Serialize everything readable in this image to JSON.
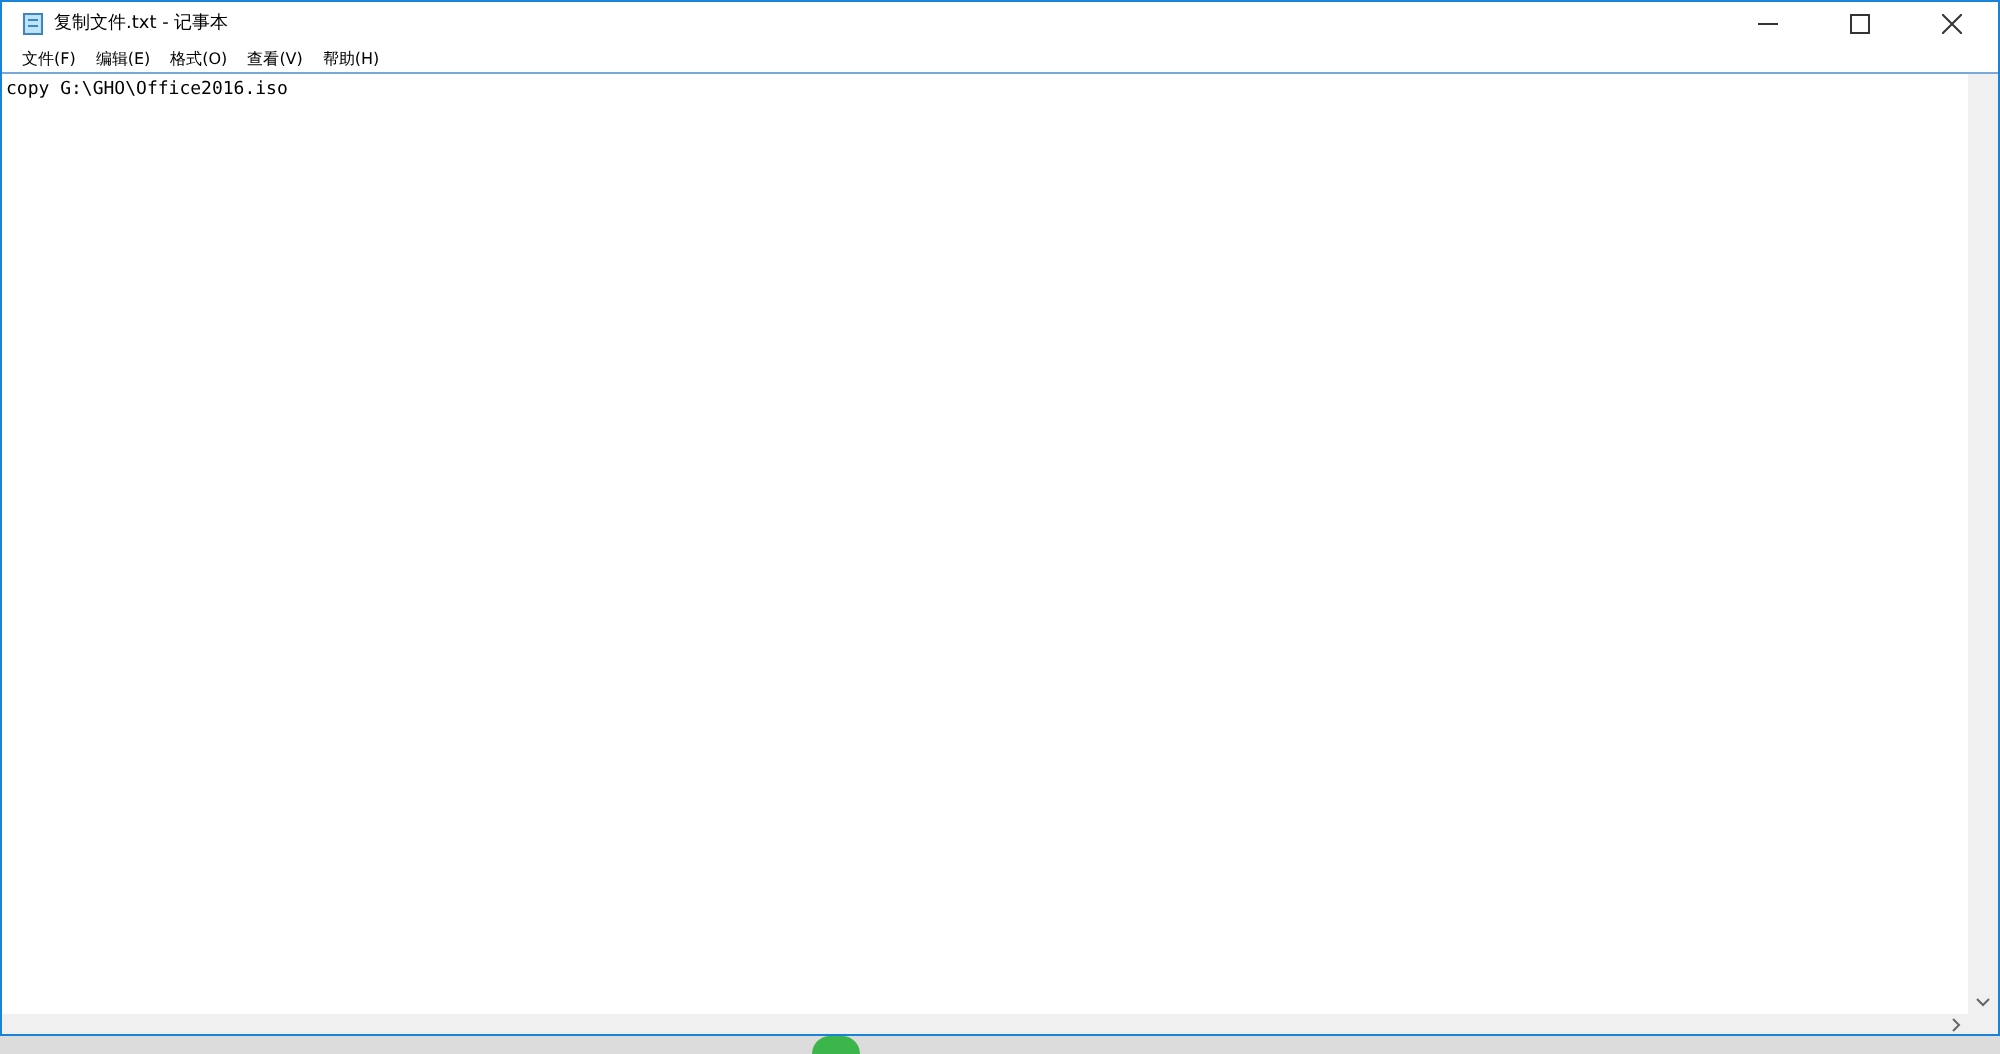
{
  "window": {
    "title": "复制文件.txt - 记事本"
  },
  "menu": [
    "文件(F)",
    "编辑(E)",
    "格式(O)",
    "查看(V)",
    "帮助(H)"
  ],
  "editor": {
    "value": "copy G:\\GHO\\Office2016.iso"
  }
}
